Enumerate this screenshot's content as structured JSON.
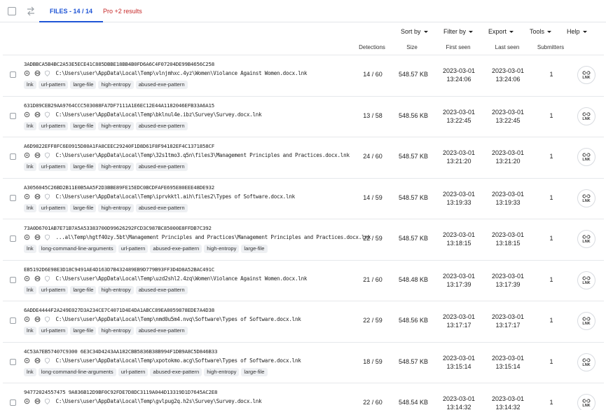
{
  "tabs": {
    "files_label": "FILES - 14 / 14",
    "pro_label": "Pro +2 results"
  },
  "toolbar": {
    "sort_by": "Sort by",
    "filter_by": "Filter by",
    "export": "Export",
    "tools": "Tools",
    "help": "Help"
  },
  "columns": {
    "detections": "Detections",
    "size": "Size",
    "first_seen": "First seen",
    "last_seen": "Last seen",
    "submitters": "Submitters"
  },
  "colors": {
    "accent": "#1f55d6",
    "pro": "#c62828",
    "tag_bg": "#eef0f3"
  },
  "rows": [
    {
      "hash": "3ADBBCA5B4BC2A53E5ECE41C885DBBE18BB4B0FD6A6C4F07204DE99B4656C258",
      "path": "C:\\Users\\user\\AppData\\Local\\Temp\\vlnjmhxc.4yz\\Women\\Violance Against Women.docx.lnk",
      "tags": [
        "lnk",
        "url-pattern",
        "large-file",
        "high-entropy",
        "abused-exe-pattern"
      ],
      "detections": "14 / 60",
      "size": "548.57 KB",
      "first_seen_date": "2023-03-01",
      "first_seen_time": "13:24:06",
      "last_seen_date": "2023-03-01",
      "last_seen_time": "13:24:06",
      "submitters": "1",
      "type_badge": "LNK"
    },
    {
      "hash": "631D89CEB29AA9764CCC503088FA7DF7111A1E6EC12E44A1182046EFB33A6A15",
      "path": "C:\\Users\\user\\AppData\\Local\\Temp\\bklnul4e.ibz\\Survey\\Survey.docx.lnk",
      "tags": [
        "lnk",
        "url-pattern",
        "large-file",
        "high-entropy",
        "abused-exe-pattern"
      ],
      "detections": "13 / 58",
      "size": "548.56 KB",
      "first_seen_date": "2023-03-01",
      "first_seen_time": "13:22:45",
      "last_seen_date": "2023-03-01",
      "last_seen_time": "13:22:45",
      "submitters": "1",
      "type_badge": "LNK"
    },
    {
      "hash": "A6D9822EFF8FC6E0915D80A1FA8CEEC29240F1D8D61F8F94182EF4C1371858CF",
      "path": "C:\\Users\\user\\AppData\\Local\\Temp\\32s1tmo3.q5n\\files3\\Management Principles and Practices.docx.lnk",
      "tags": [
        "lnk",
        "url-pattern",
        "large-file",
        "high-entropy",
        "abused-exe-pattern"
      ],
      "detections": "24 / 60",
      "size": "548.57 KB",
      "first_seen_date": "2023-03-01",
      "first_seen_time": "13:21:20",
      "last_seen_date": "2023-03-01",
      "last_seen_time": "13:21:20",
      "submitters": "1",
      "type_badge": "LNK"
    },
    {
      "hash": "A3056045C26BD2B11E0B5AA5F2D3BBE89FE15EDC0BCDFAFE695E80EEE48DE932",
      "path": "C:\\Users\\user\\AppData\\Local\\Temp\\iprvkktl.aih\\files2\\Types of Software.docx.lnk",
      "tags": [
        "lnk",
        "url-pattern",
        "large-file",
        "high-entropy",
        "abused-exe-pattern"
      ],
      "detections": "14 / 59",
      "size": "548.57 KB",
      "first_seen_date": "2023-03-01",
      "first_seen_time": "13:19:33",
      "last_seen_date": "2023-03-01",
      "last_seen_time": "13:19:33",
      "submitters": "1",
      "type_badge": "LNK"
    },
    {
      "hash": "73A0D6701AB7E71B7A5A53383700D99626292FCD3C987BC85000E8FFDB7C392",
      "path": "...al\\Temp\\hgtf40zy.5bt\\Management Principles and Practices\\Management Principles and Practices.docx.lnk",
      "tags": [
        "lnk",
        "long-command-line-arguments",
        "url-pattern",
        "abused-exe-pattern",
        "high-entropy",
        "large-file"
      ],
      "detections": "22 / 59",
      "size": "548.57 KB",
      "first_seen_date": "2023-03-01",
      "first_seen_time": "13:18:15",
      "last_seen_date": "2023-03-01",
      "last_seen_time": "13:18:15",
      "submitters": "1",
      "type_badge": "LNK"
    },
    {
      "hash": "EB5192D6E98E3D18C9491AE4D163D7B432489EB9D779B93FF3D4D8A52BAC491C",
      "path": "C:\\Users\\user\\AppData\\Local\\Temp\\uzd2shl2.4zq\\Women\\Violance Against Women.docx.lnk",
      "tags": [
        "lnk",
        "url-pattern",
        "large-file",
        "high-entropy",
        "abused-exe-pattern"
      ],
      "detections": "21 / 60",
      "size": "548.48 KB",
      "first_seen_date": "2023-03-01",
      "first_seen_time": "13:17:39",
      "last_seen_date": "2023-03-01",
      "last_seen_time": "13:17:39",
      "submitters": "1",
      "type_badge": "LNK"
    },
    {
      "hash": "6ADDE4444F2A249E027D3A234CE7C4071D4E4DA1ABCC89EA8059878EDE7A4D38",
      "path": "C:\\Users\\user\\AppData\\Local\\Temp\\nmd0u5m4.nvq\\Software\\Types of Software.docx.lnk",
      "tags": [
        "lnk",
        "url-pattern",
        "large-file",
        "high-entropy",
        "abused-exe-pattern"
      ],
      "detections": "22 / 59",
      "size": "548.56 KB",
      "first_seen_date": "2023-03-01",
      "first_seen_time": "13:17:17",
      "last_seen_date": "2023-03-01",
      "last_seen_time": "13:17:17",
      "submitters": "1",
      "type_badge": "LNK"
    },
    {
      "hash": "4C53A7EB57407C9300 6E3C34D4243AA182CBB5836B38B994F1DB9A8C5D846B33",
      "path": "C:\\Users\\user\\AppData\\Local\\Temp\\xpotokmo.acg\\Software\\Types of Software.docx.lnk",
      "tags": [
        "lnk",
        "long-command-line-arguments",
        "url-pattern",
        "abused-exe-pattern",
        "high-entropy",
        "large-file"
      ],
      "detections": "18 / 59",
      "size": "548.57 KB",
      "first_seen_date": "2023-03-01",
      "first_seen_time": "13:15:14",
      "last_seen_date": "2023-03-01",
      "last_seen_time": "13:15:14",
      "submitters": "1",
      "type_badge": "LNK"
    },
    {
      "hash": "94772024557475 9A836B12D9BF0C92FDE7D8DC3119A044D13319D1D7645AC2E8",
      "path": "C:\\Users\\user\\AppData\\Local\\Temp\\gvlpug2q.h2s\\Survey\\Survey.docx.lnk",
      "tags": [],
      "detections": "22 / 60",
      "size": "548.54 KB",
      "first_seen_date": "2023-03-01",
      "first_seen_time": "13:14:32",
      "last_seen_date": "2023-03-01",
      "last_seen_time": "13:14:32",
      "submitters": "1",
      "type_badge": "LNK"
    }
  ]
}
